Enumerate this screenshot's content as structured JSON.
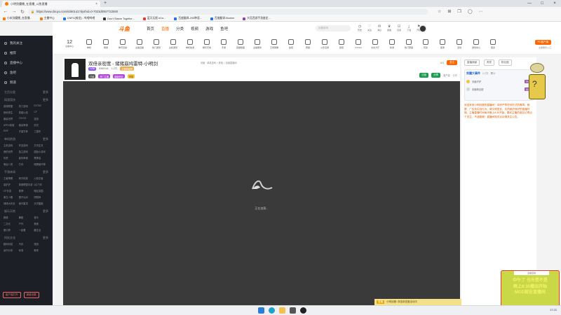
{
  "browser": {
    "tab_title": "小明剑魔播_在直播_斗鱼直播",
    "tab_close": "×",
    "new_tab": "+",
    "url": "https://www.douyu.com/6360141?dyshid=0-7023d0067722590",
    "window_controls": [
      "—",
      "□",
      "×"
    ],
    "bookmarks": [
      {
        "label": "小米剑魔播_在直播..",
        "color": "#f70"
      },
      {
        "label": "主播中心",
        "color": "#f70"
      },
      {
        "label": "CNPC(蛟龙) - 哔哩哔哩",
        "color": "#1a73e8"
      },
      {
        "label": "Don't Starve Togethe...",
        "color": "#333"
      },
      {
        "label": "蓝天无限 of.io...",
        "color": "#e53935"
      },
      {
        "label": "百度翻译-200种语...",
        "color": "#1a73e8"
      },
      {
        "label": "百度翻译-Bookm",
        "color": "#1a73e8"
      },
      {
        "label": "大话西游手游鉴定...",
        "color": "#8e44ad"
      }
    ]
  },
  "sidebar": {
    "items": [
      {
        "label": "我的关注"
      },
      {
        "label": "推荐"
      },
      {
        "label": "直播中心"
      },
      {
        "label": "鱼吧"
      },
      {
        "label": "频道"
      }
    ],
    "sections": [
      {
        "title": "主页分类",
        "more": "更多"
      },
      {
        "title": "网游竞技",
        "more": "更多",
        "items": [
          "英雄联盟",
          "热门游戏",
          "DOTA2",
          "绝地求生",
          "穿越火线",
          "CF",
          "魔兽世界",
          "CS:GO",
          "逆战",
          "APEX英雄",
          "魔兽争霸",
          "剑灵",
          "DNF",
          "守望先锋",
          "三国杀"
        ]
      },
      {
        "title": "单机热游",
        "more": "更多",
        "items": [
          "主机游戏",
          "怀旧游戏",
          "方舟生存",
          "我的世界",
          "独立游戏",
          "甜品小游戏",
          "饥荒",
          "星际争霸",
          "黑神话",
          "鬼谷八荒",
          "方舟",
          "暗黑破坏神"
        ]
      },
      {
        "title": "手游休闲",
        "more": "更多",
        "items": [
          "王者荣耀",
          "和平精英",
          "火影忍者",
          "金铲铲",
          "英雄联盟手游",
          "QQ飞车",
          "CF手游",
          "原神",
          "暗区突围",
          "第五人格",
          "蛋仔派对",
          "阴阳师",
          "球球大作战",
          "崩坏星穹",
          "天天酷跑"
        ]
      },
      {
        "title": "娱乐天地",
        "more": "更多",
        "items": [
          "颜值",
          "舞蹈",
          "音乐",
          "二次元",
          "户外",
          "美食",
          "脱口秀",
          "一起看",
          "趣生活"
        ]
      },
      {
        "title": "科技文化",
        "more": "更多",
        "items": [
          "数码科技",
          "汽车",
          "旅游",
          "读书分享",
          "军事",
          "教育"
        ]
      }
    ],
    "bottom_buttons": [
      "客户端打开",
      "弹幕设置"
    ]
  },
  "header": {
    "logo": "斗鱼",
    "nav": [
      {
        "label": "首页",
        "active": false
      },
      {
        "label": "直播",
        "active": true
      },
      {
        "label": "分类",
        "active": false
      },
      {
        "label": "视频",
        "active": false
      },
      {
        "label": "游戏",
        "active": false
      },
      {
        "label": "鱼吧",
        "active": false
      }
    ],
    "search_placeholder": "剑魔游戏",
    "icons": [
      {
        "icon": "history-icon",
        "label": "历史"
      },
      {
        "icon": "follow-icon",
        "label": "关注"
      },
      {
        "icon": "message-icon",
        "label": "消息"
      },
      {
        "icon": "vip-icon",
        "label": "贵族"
      },
      {
        "icon": "task-icon",
        "label": "任务"
      },
      {
        "icon": "download-icon",
        "label": "下载"
      },
      {
        "icon": "live-icon",
        "label": "开播"
      }
    ]
  },
  "categories": {
    "first": {
      "number": "12",
      "label": "主播中心"
    },
    "items": [
      "单机",
      "网游",
      "体育竞技",
      "主播直播",
      "热门游戏",
      "主机游戏",
      "单机热游",
      "娱乐天地",
      "手游",
      "英雄联盟",
      "主播服务",
      "王者荣耀",
      "鱼吧",
      "赛事",
      "火影忍者",
      "颜值",
      "CS:GO",
      "交友大厅",
      "新游",
      "热门赛事",
      "有奖",
      "星秀",
      "活动",
      "游戏中心",
      "更多"
    ],
    "pc_button": "PC客户端",
    "pc_sub": "主播服务入口"
  },
  "room": {
    "title": "双倍亲密度 - 猪猪崩鸠雷特-小明剑",
    "extra": "剑魔 · 单机游戏 > 其他 > 剑魔直播间",
    "level_badge": "LV58",
    "room_id": "6360141",
    "badges": [
      "热门主播",
      "超级粉丝",
      "主播等级榜"
    ],
    "tags": [
      "订阅",
      "举报",
      "分享"
    ],
    "share_count": "1.2万",
    "follow_label": "关注",
    "follow_count": "103",
    "green_buttons": [
      "订阅",
      "分享"
    ],
    "right_small": [
      "客户端",
      "分享"
    ]
  },
  "player": {
    "loading_text": "正在加载..."
  },
  "player_banner": {
    "tag": "直播",
    "text": "小明剑魔: 双倍亲密度活动中"
  },
  "right_panel": {
    "tabs": [
      "直播贡献",
      "贵宾",
      "粉丝团"
    ],
    "card_title": "剑魔大事件",
    "card_sub": "1.2万 · 累计",
    "rank_items": [
      {
        "name": "剑魔守护",
        "tag": "守护"
      },
      {
        "name": "剑魔粉丝团",
        "tag": "贵宾"
      }
    ],
    "notice": "欢迎来到小明剑魔的直播间！本房严禁任何形式的辱骂、刷屏、广告及引战行为，请文明发言，共同维护良好的直播环境。主播直播时间每天晚上8:30开始，喜欢主播的朋友记得点个关注，不迷路哦！直播间相关活动请关注公告。"
  },
  "promo": {
    "top": "主播活动",
    "lines": [
      "中午了 也许是不是",
      "晚上8:30播出开始",
      "MOD就在直播间"
    ]
  },
  "taskbar": {
    "time": "17:22"
  }
}
